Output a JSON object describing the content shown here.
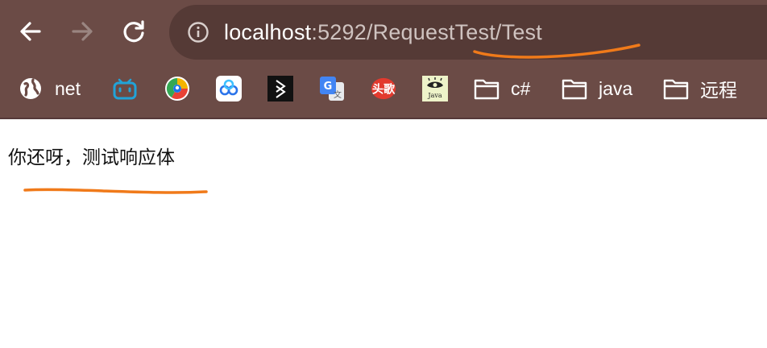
{
  "toolbar": {
    "url_host": "localhost",
    "url_path": ":5292/RequestTest/Test"
  },
  "bookmarks": [
    {
      "label": "net",
      "icon": "globe-icon"
    },
    {
      "label": "",
      "icon": "bilibili-icon"
    },
    {
      "label": "",
      "icon": "qq-browser-icon"
    },
    {
      "label": "",
      "icon": "cloud-link-icon"
    },
    {
      "label": "",
      "icon": "dark-app-icon"
    },
    {
      "label": "",
      "icon": "google-translate-icon"
    },
    {
      "label": "头歌",
      "icon": "touge-icon"
    },
    {
      "label": "Java",
      "icon": "java-eye-icon"
    },
    {
      "label": "c#",
      "icon": "folder-icon"
    },
    {
      "label": "java",
      "icon": "folder-icon"
    },
    {
      "label": "远程",
      "icon": "folder-icon"
    }
  ],
  "page": {
    "body_text": "你还呀，测试响应体"
  },
  "colors": {
    "chrome_bg": "#6b4b46",
    "omnibox_bg": "#553a36",
    "annotation": "#f07a1a"
  }
}
